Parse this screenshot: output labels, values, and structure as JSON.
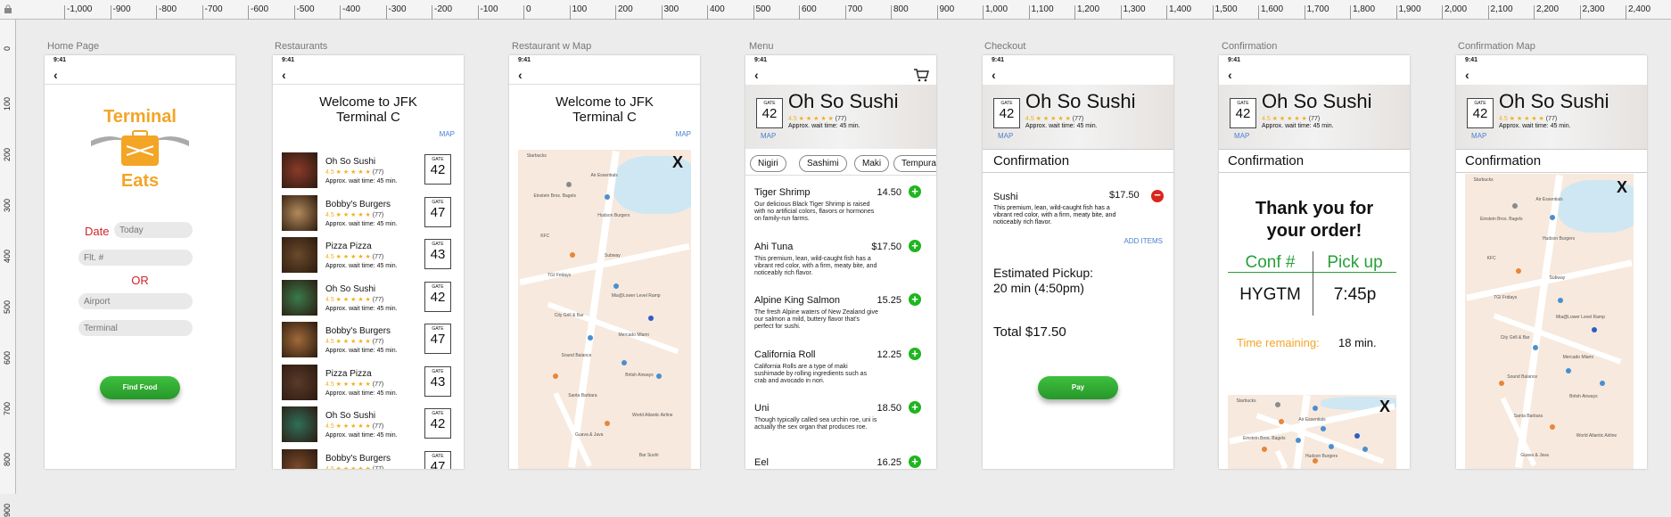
{
  "ruler": {
    "top": [
      "-1,000",
      "-900",
      "-800",
      "-700",
      "-600",
      "-500",
      "-400",
      "-300",
      "-200",
      "-100",
      "0",
      "100",
      "200",
      "300",
      "400",
      "500",
      "600",
      "700",
      "800",
      "900",
      "1,000",
      "1,100",
      "1,200",
      "1,300",
      "1,400",
      "1,500",
      "1,600",
      "1,700",
      "1,800",
      "1,900",
      "2,000",
      "2,100",
      "2,200",
      "2,300",
      "2,400"
    ],
    "left": [
      "0",
      "100",
      "200",
      "300",
      "400",
      "500",
      "600",
      "700",
      "800",
      "900"
    ]
  },
  "status_time": "9:41",
  "back_glyph": "‹",
  "gate_label": "GATE",
  "map_link": "MAP",
  "close_x": "X",
  "stars": "4.5 ★ ★ ★ ★ ★",
  "count": "(77)",
  "wait": "Approx. wait time: 45 min.",
  "artboards": {
    "home": {
      "label": "Home Page",
      "logo_top": "Terminal",
      "logo_bottom": "Eats",
      "date_label": "Date",
      "date_placeholder": "Today",
      "flight_placeholder": "Flt. #",
      "or": "OR",
      "airport_placeholder": "Airport",
      "terminal_placeholder": "Terminal",
      "button": "Find Food"
    },
    "restaurants": {
      "label": "Restaurants",
      "title_line1": "Welcome to JFK",
      "title_line2": "Terminal C",
      "rows": [
        {
          "name": "Oh So Sushi",
          "gate": "42"
        },
        {
          "name": "Bobby's Burgers",
          "gate": "47"
        },
        {
          "name": "Pizza Pizza",
          "gate": "43"
        },
        {
          "name": "Oh So Sushi",
          "gate": "42"
        },
        {
          "name": "Bobby's Burgers",
          "gate": "47"
        },
        {
          "name": "Pizza Pizza",
          "gate": "43"
        },
        {
          "name": "Oh So Sushi",
          "gate": "42"
        },
        {
          "name": "Bobby's Burgers",
          "gate": "47"
        }
      ]
    },
    "restaurant_map": {
      "label": "Restaurant w Map",
      "title_line1": "Welcome to JFK",
      "title_line2": "Terminal C"
    },
    "menu": {
      "label": "Menu",
      "restaurant": "Oh So Sushi",
      "gate": "42",
      "tabs": [
        "Nigiri",
        "Sashimi",
        "Maki",
        "Tempura"
      ],
      "items": [
        {
          "name": "Tiger Shrimp",
          "price": "14.50",
          "desc": "Our delicious Black Tiger Shrimp is raised with no artificial colors, flavors or hormones on family-run farms."
        },
        {
          "name": "Ahi Tuna",
          "price": "$17.50",
          "desc": "This premium, lean, wild-caught fish has a vibrant red color, with a firm, meaty bite, and noticeably rich flavor."
        },
        {
          "name": "Alpine King Salmon",
          "price": "15.25",
          "desc": "The fresh Alpine waters of New Zealand give our salmon a mild, buttery flavor that's perfect for sushi."
        },
        {
          "name": "California Roll",
          "price": "12.25",
          "desc": "California Rolls are a type of maki sushimade by rolling ingredients such as crab and avocado in nori."
        },
        {
          "name": "Uni",
          "price": "18.50",
          "desc": "Though typically called sea urchin roe, uni is actually the sex organ that produces roe."
        },
        {
          "name": "Eel",
          "price": "16.25",
          "desc": ""
        }
      ]
    },
    "checkout": {
      "label": "Checkout",
      "restaurant": "Oh So Sushi",
      "gate": "42",
      "section": "Confirmation",
      "item_name": "Sushi",
      "item_price": "$17.50",
      "item_desc": "This premium, lean, wild-caught fish has a vibrant red color, with a firm, meaty bite, and noticeably rich flavor.",
      "add_items": "ADD ITEMS",
      "pickup_line1": "Estimated Pickup:",
      "pickup_line2": "20 min (4:50pm)",
      "total": "Total $17.50",
      "button": "Pay"
    },
    "confirmation": {
      "label": "Confirmation",
      "restaurant": "Oh So Sushi",
      "gate": "42",
      "section": "Confirmation",
      "thanks_line1": "Thank you for",
      "thanks_line2": "your order!",
      "conf_header": "Conf #",
      "pickup_header": "Pick up",
      "conf_value": "HYGTM",
      "pickup_value": "7:45p",
      "time_label": "Time remaining:",
      "time_value": "18 min."
    },
    "confirmation_map": {
      "label": "Confirmation Map",
      "restaurant": "Oh So Sushi",
      "gate": "42",
      "section": "Confirmation"
    }
  },
  "map_labels": [
    "Starbucks",
    "Air Essentials",
    "Einstein Bros. Bagels",
    "Hudson Burgers",
    "KFC",
    "Subway",
    "TGI Fridays",
    "Mia@Lower Level Ramp",
    "City Grill & Bar",
    "Mercado Mlami",
    "Sound Balance",
    "Britsh Airways",
    "Santa Barbara",
    "World Atlantic Airline",
    "Guava & Java",
    "Bar Sushi"
  ],
  "colors": {
    "accent_orange": "#f3a526",
    "accent_red": "#d2232a",
    "green": "#1fb51f",
    "link_blue": "#4a7fd0"
  }
}
